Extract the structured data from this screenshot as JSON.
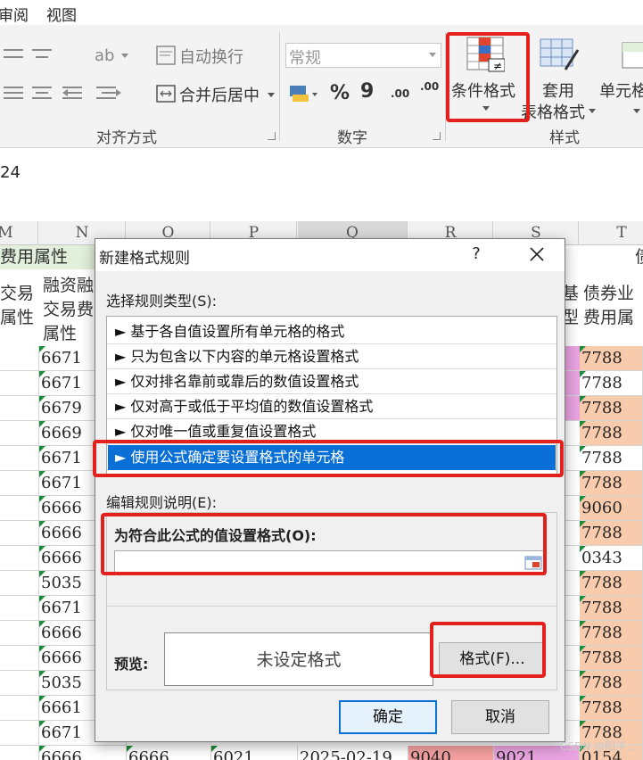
{
  "ribbon": {
    "tabs": [
      "审阅",
      "视图"
    ],
    "wrap_text": "自动换行",
    "merge_center": "合并后居中",
    "number_format": "常规",
    "percent": "%",
    "comma": "9",
    "inc_decimal": ".00",
    "dec_decimal": ".00",
    "cond_format": "条件格式",
    "table_format_1": "套用",
    "table_format_2": "表格格式",
    "cell_styles": "单元格",
    "groups": {
      "alignment": "对齐方式",
      "number": "数字",
      "styles": "样式"
    }
  },
  "formula_bar": {
    "value": "24"
  },
  "sheet": {
    "columns": [
      "M",
      "N",
      "O",
      "P",
      "Q",
      "R",
      "S",
      "T"
    ],
    "headers": {
      "left_group": "费用属性",
      "m": [
        "交易",
        "属性"
      ],
      "n": [
        "融资融",
        "交易费",
        "属性"
      ],
      "s_partial": [
        "基",
        "型"
      ],
      "t": [
        "债券业",
        "费用属"
      ],
      "t_top_partial": "债"
    },
    "n_values": [
      "6671",
      "6671",
      "6679",
      "6669",
      "6671",
      "6671",
      "6666",
      "6666",
      "6666",
      "5035",
      "6671",
      "6666",
      "6666",
      "5035",
      "6661",
      "6671",
      "6666"
    ],
    "t_values": [
      "7788",
      "7788",
      "7788",
      "7788",
      "7788",
      "7788",
      "9060",
      "7788",
      "0343",
      "7788",
      "7788",
      "7788",
      "7788",
      "7788",
      "7788",
      "7788",
      "0154"
    ],
    "bottom_row": {
      "o": "6666",
      "p": "6021",
      "q": "2025-02-19",
      "r": "9040",
      "s": "9021"
    }
  },
  "dialog": {
    "title": "新建格式规则",
    "help": "?",
    "select_label": "选择规则类型(S):",
    "rule_types": [
      "► 基于各自值设置所有单元格的格式",
      "► 只为包含以下内容的单元格设置格式",
      "► 仅对排名靠前或靠后的数值设置格式",
      "► 仅对高于或低于平均值的数值设置格式",
      "► 仅对唯一值或重复值设置格式",
      "► 使用公式确定要设置格式的单元格"
    ],
    "edit_label": "编辑规则说明(E):",
    "formula_label": "为符合此公式的值设置格式(O):",
    "formula_value": "",
    "preview_label": "预览:",
    "preview_text": "未设定格式",
    "format_button": "格式(F)...",
    "ok": "确定",
    "cancel": "取消"
  },
  "colors": {
    "accent": "#0a6fd6",
    "highlight": "#e3201b",
    "peach": "#f8cbad",
    "pink": "#e9a3e0",
    "green_header": "#e2efda"
  },
  "watermark": "CSDN @阳子..."
}
